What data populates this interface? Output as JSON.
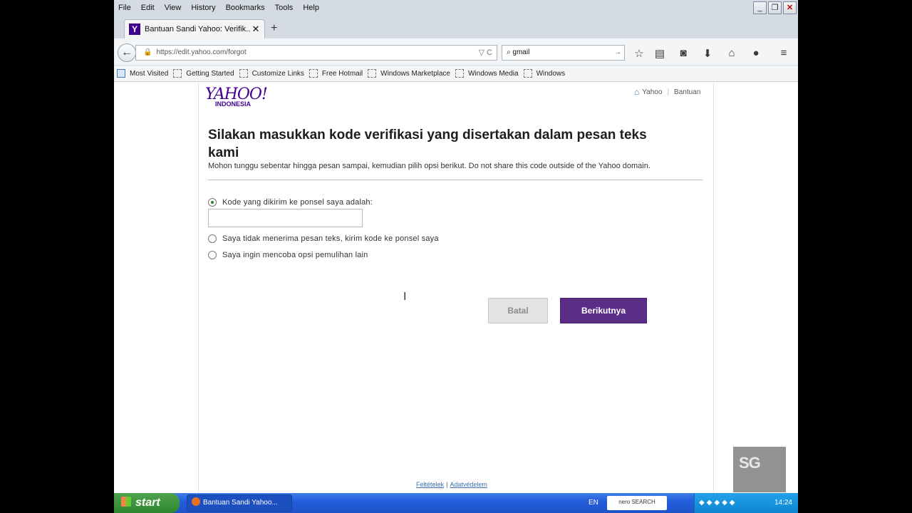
{
  "menubar": {
    "items": [
      "File",
      "Edit",
      "View",
      "History",
      "Bookmarks",
      "Tools",
      "Help"
    ]
  },
  "window_controls": {
    "minimize": "_",
    "restore": "❐",
    "close": "✕"
  },
  "tab": {
    "favicon_letter": "Y",
    "title": "Bantuan Sandi Yahoo: Verifik...",
    "close": "✕",
    "new_tab": "+"
  },
  "nav": {
    "back_glyph": "←",
    "url": "https://edit.yahoo.com/forgot",
    "url_right": "▽ C",
    "search_value": "gmail",
    "search_go": "→"
  },
  "icons": {
    "bookmark_star": "star-icon",
    "reading_list": "reading-list-icon",
    "pocket": "pocket-icon",
    "downloads": "download-icon",
    "home": "home-icon",
    "chat": "chat-icon",
    "menu": "hamburger-menu-icon"
  },
  "bookmarks": [
    "Most Visited",
    "Getting Started",
    "Customize Links",
    "Free Hotmail",
    "Windows Marketplace",
    "Windows Media",
    "Windows"
  ],
  "page": {
    "logo": {
      "brand": "YAHOO!",
      "region": "INDONESIA"
    },
    "top_links": {
      "yahoo": "Yahoo",
      "separator": "|",
      "help": "Bantuan"
    },
    "heading": "Silakan masukkan kode verifikasi yang disertakan dalam pesan teks kami",
    "subtext": "Mohon tunggu sebentar hingga pesan sampai, kemudian pilih opsi berikut. Do not share this code outside of the Yahoo domain.",
    "options": [
      {
        "label": "Kode yang dikirim ke ponsel saya adalah:",
        "checked": true
      },
      {
        "label": "Saya tidak menerima pesan teks, kirim kode ke ponsel saya",
        "checked": false
      },
      {
        "label": "Saya ingin mencoba opsi pemulihan lain",
        "checked": false
      }
    ],
    "code_input_value": "",
    "buttons": {
      "cancel": "Batal",
      "next": "Berikutnya"
    },
    "footer": {
      "terms": "Feltételek",
      "separator": "|",
      "privacy": "Adatvédelem"
    },
    "watermark": "SG"
  },
  "taskbar": {
    "start": "start",
    "task": "Bantuan Sandi Yahoo...",
    "language": "EN",
    "nero": "nero SEARCH",
    "clock": "14:24"
  },
  "colors": {
    "yahoo_purple": "#400090",
    "next_button": "#5a2d87",
    "taskbar_blue": "#245edb",
    "start_green": "#3a913a"
  }
}
